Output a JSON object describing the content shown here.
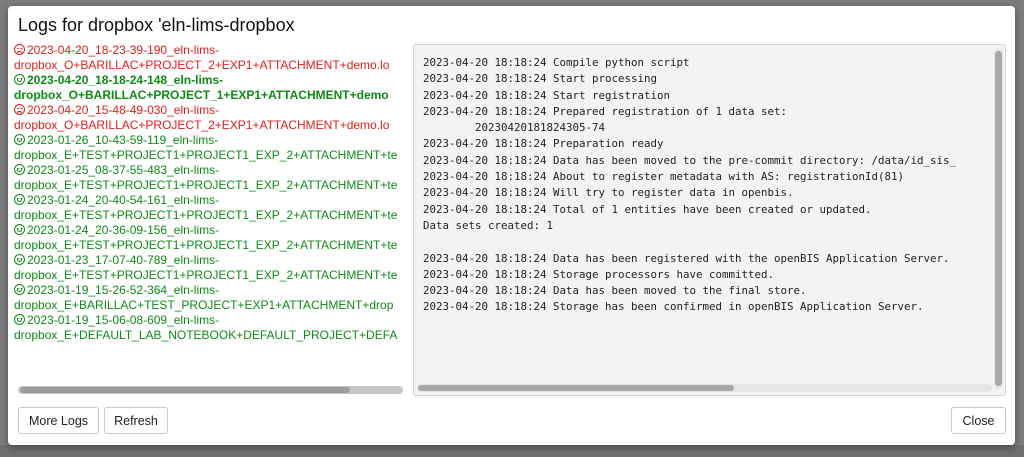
{
  "dialog": {
    "title": "Logs for dropbox 'eln-lims-dropbox"
  },
  "log_files": [
    {
      "status": "error",
      "selected": false,
      "line1": "2023-04-20_18-23-39-190_eln-lims-",
      "line2": "dropbox_O+BARILLAC+PROJECT_2+EXP1+ATTACHMENT+demo.lo"
    },
    {
      "status": "ok",
      "selected": true,
      "line1": "2023-04-20_18-18-24-148_eln-lims-",
      "line2": "dropbox_O+BARILLAC+PROJECT_1+EXP1+ATTACHMENT+demo"
    },
    {
      "status": "error",
      "selected": false,
      "line1": "2023-04-20_15-48-49-030_eln-lims-",
      "line2": "dropbox_O+BARILLAC+PROJECT_2+EXP1+ATTACHMENT+demo.lo"
    },
    {
      "status": "ok",
      "selected": false,
      "line1": "2023-01-26_10-43-59-119_eln-lims-",
      "line2": "dropbox_E+TEST+PROJECT1+PROJECT1_EXP_2+ATTACHMENT+te"
    },
    {
      "status": "ok",
      "selected": false,
      "line1": "2023-01-25_08-37-55-483_eln-lims-",
      "line2": "dropbox_E+TEST+PROJECT1+PROJECT1_EXP_2+ATTACHMENT+te"
    },
    {
      "status": "ok",
      "selected": false,
      "line1": "2023-01-24_20-40-54-161_eln-lims-",
      "line2": "dropbox_E+TEST+PROJECT1+PROJECT1_EXP_2+ATTACHMENT+te"
    },
    {
      "status": "ok",
      "selected": false,
      "line1": "2023-01-24_20-36-09-156_eln-lims-",
      "line2": "dropbox_E+TEST+PROJECT1+PROJECT1_EXP_2+ATTACHMENT+te"
    },
    {
      "status": "ok",
      "selected": false,
      "line1": "2023-01-23_17-07-40-789_eln-lims-",
      "line2": "dropbox_E+TEST+PROJECT1+PROJECT1_EXP_2+ATTACHMENT+te"
    },
    {
      "status": "ok",
      "selected": false,
      "line1": "2023-01-19_15-26-52-364_eln-lims-",
      "line2": "dropbox_E+BARILLAC+TEST_PROJECT+EXP1+ATTACHMENT+drop"
    },
    {
      "status": "ok",
      "selected": false,
      "line1": "2023-01-19_15-06-08-609_eln-lims-",
      "line2": "dropbox_E+DEFAULT_LAB_NOTEBOOK+DEFAULT_PROJECT+DEFA"
    }
  ],
  "log_content": [
    "2023-04-20 18:18:24 Compile python script",
    "2023-04-20 18:18:24 Start processing",
    "2023-04-20 18:18:24 Start registration",
    "2023-04-20 18:18:24 Prepared registration of 1 data set:",
    "        20230420181824305-74",
    "2023-04-20 18:18:24 Preparation ready",
    "2023-04-20 18:18:24 Data has been moved to the pre-commit directory: /data/id_sis_",
    "2023-04-20 18:18:24 About to register metadata with AS: registrationId(81)",
    "2023-04-20 18:18:24 Will try to register data in openbis.",
    "2023-04-20 18:18:24 Total of 1 entities have been created or updated.",
    "Data sets created: 1",
    "",
    "2023-04-20 18:18:24 Data has been registered with the openBIS Application Server.",
    "2023-04-20 18:18:24 Storage processors have committed.",
    "2023-04-20 18:18:24 Data has been moved to the final store.",
    "2023-04-20 18:18:24 Storage has been confirmed in openBIS Application Server."
  ],
  "buttons": {
    "more_logs": "More Logs",
    "refresh": "Refresh",
    "close": "Close"
  },
  "colors": {
    "error": "#e0201b",
    "ok": "#0f8a17",
    "panel_bg": "#f3f3f3"
  },
  "icons": {
    "ok": "smile-icon",
    "error": "frown-icon"
  }
}
